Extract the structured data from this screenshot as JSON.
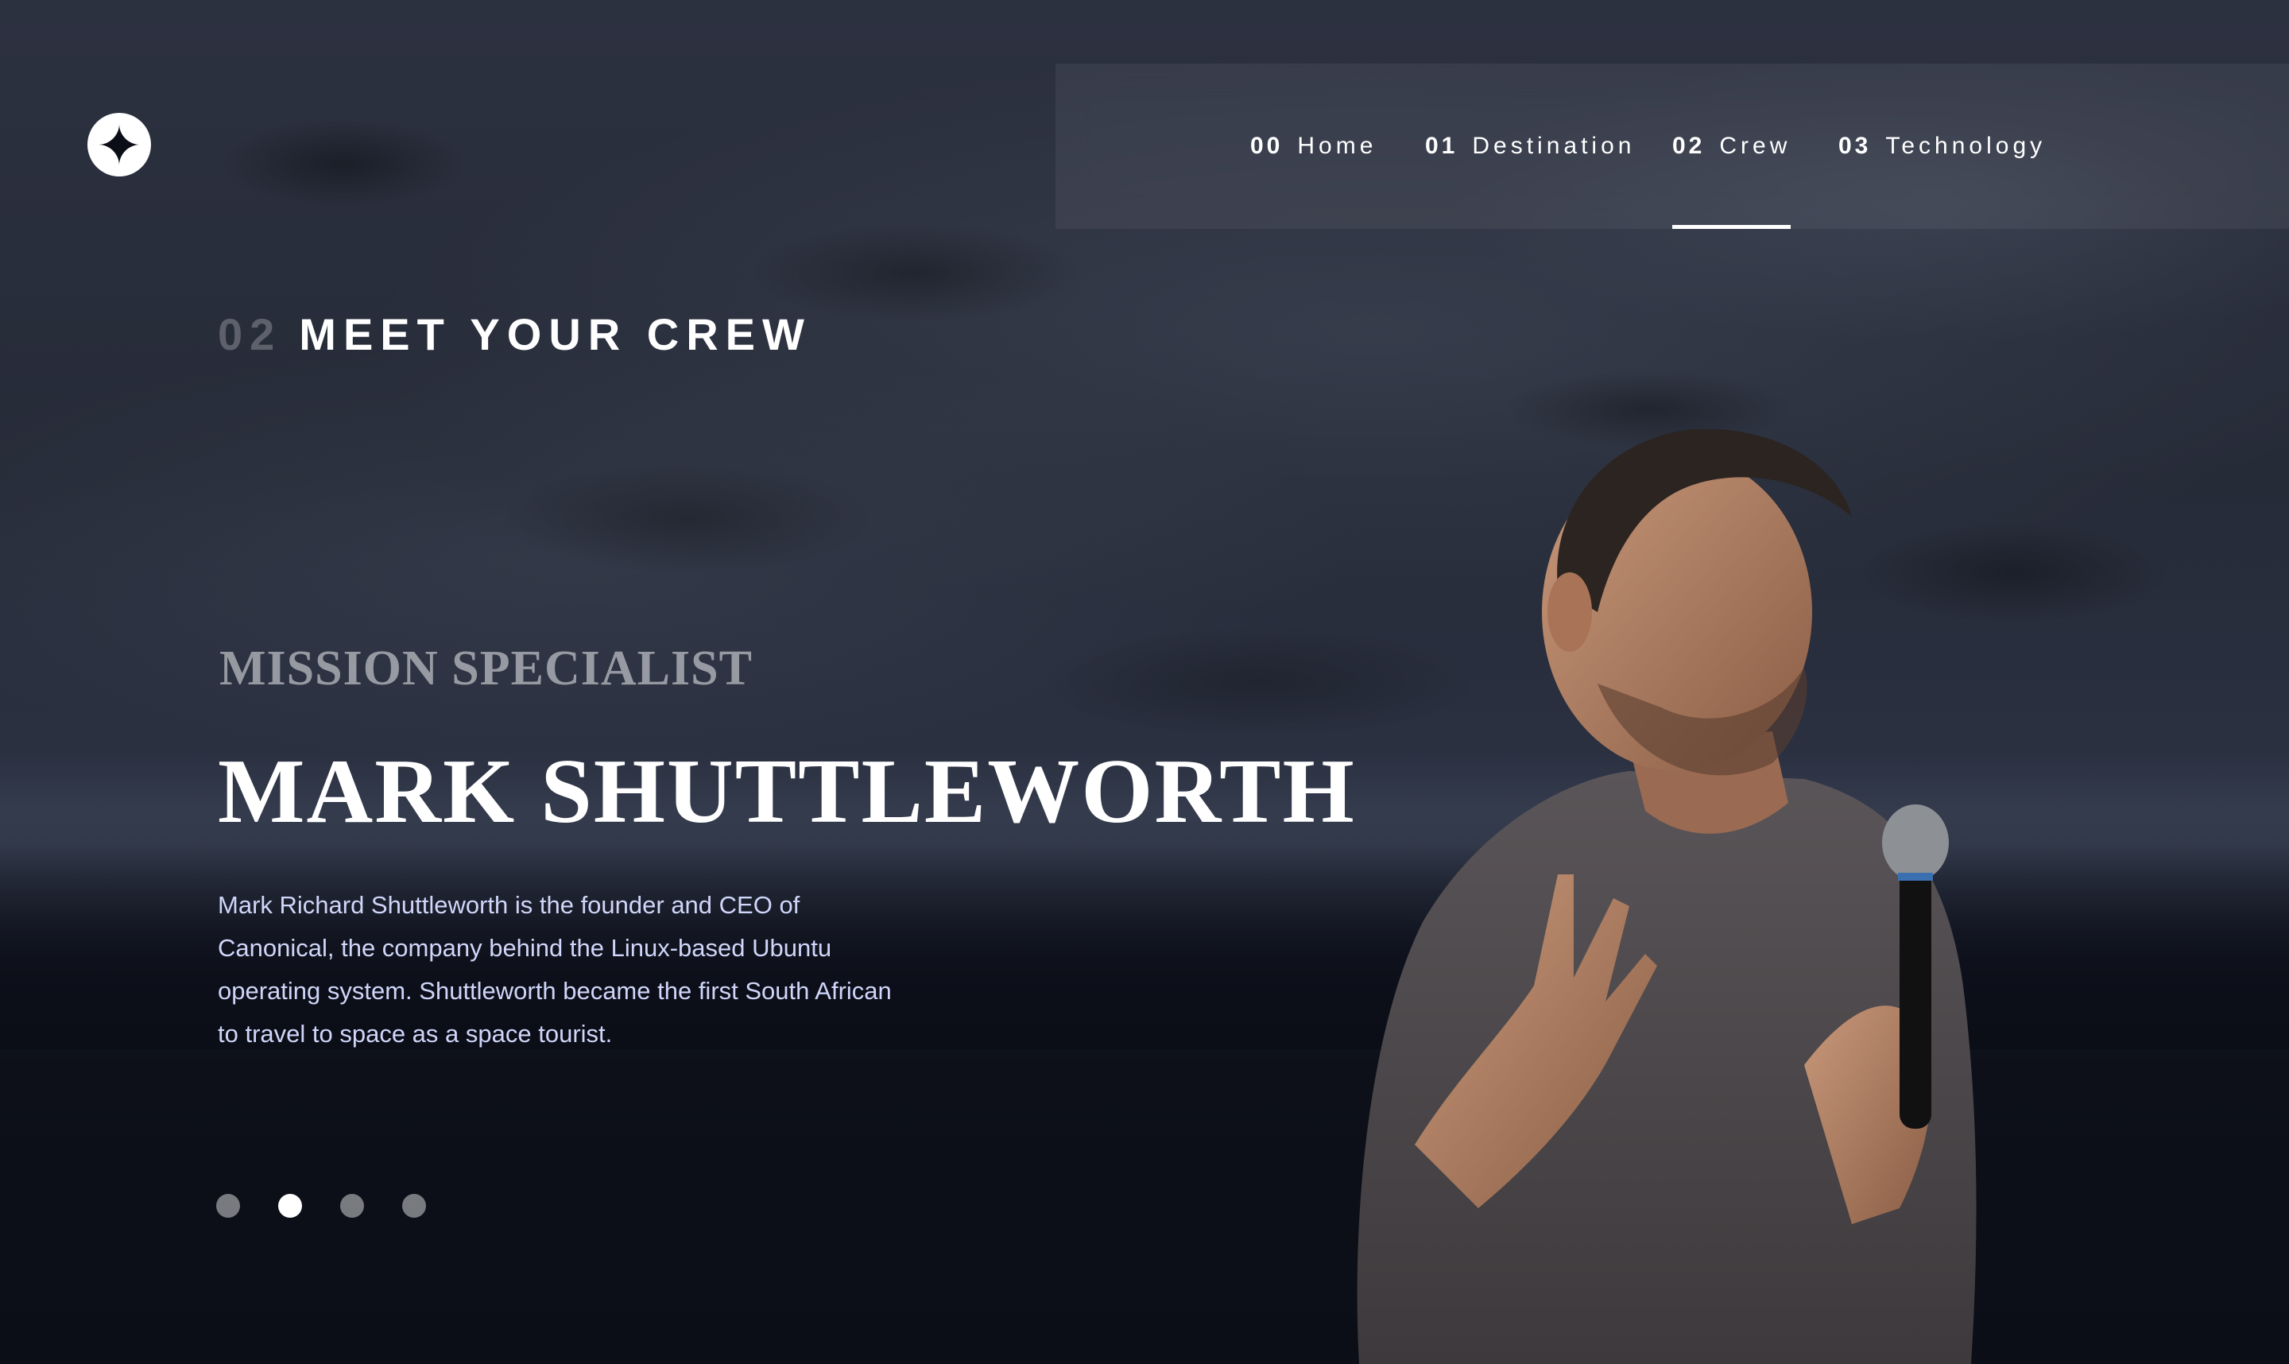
{
  "colors": {
    "background": "#0b0d17",
    "text_primary": "#ffffff",
    "text_secondary": "#d0d6f9",
    "nav_background": "rgba(255,255,255,0.06)"
  },
  "logo": {
    "icon": "star-icon"
  },
  "nav": {
    "items": [
      {
        "num": "00",
        "label": "Home",
        "active": false
      },
      {
        "num": "01",
        "label": "Destination",
        "active": false
      },
      {
        "num": "02",
        "label": "Crew",
        "active": true
      },
      {
        "num": "03",
        "label": "Technology",
        "active": false
      }
    ]
  },
  "section": {
    "num": "02",
    "title": "MEET YOUR CREW"
  },
  "crew": {
    "role": "MISSION SPECIALIST",
    "name": "MARK SHUTTLEWORTH",
    "bio": "Mark Richard Shuttleworth is the founder and CEO of Canonical, the company behind the Linux-based Ubuntu operating system. Shuttleworth became the first South African to travel to space as a space tourist."
  },
  "pagination": {
    "total": 4,
    "active_index": 1
  }
}
